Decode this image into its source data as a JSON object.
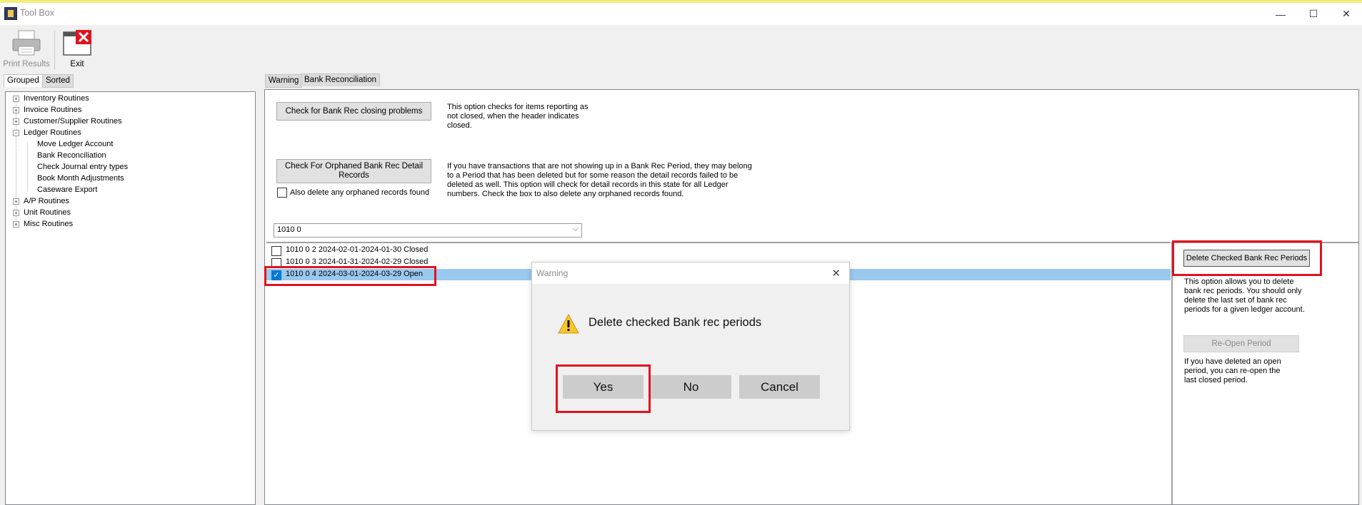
{
  "window": {
    "title": "Tool Box",
    "minimize": "—",
    "maximize": "☐",
    "close": "✕"
  },
  "toolbar": {
    "print_label": "Print Results",
    "exit_label": "Exit"
  },
  "left_tabs": {
    "grouped": "Grouped",
    "sorted": "Sorted"
  },
  "tree": {
    "items": [
      "Inventory Routines",
      "Invoice Routines",
      "Customer/Supplier Routines",
      "Ledger Routines",
      "Move Ledger Account",
      "Bank Reconciliation",
      "Check Journal entry types",
      "Book Month Adjustments",
      "Caseware Export",
      "A/P Routines",
      "Unit Routines",
      "Misc Routines"
    ]
  },
  "right_tabs": {
    "warning": "Warning",
    "bank_rec": "Bank Reconciliation"
  },
  "checks": {
    "closing_btn": "Check for Bank Rec closing problems",
    "closing_desc": "This option checks for items reporting as not closed, when the header indicates closed.",
    "orphan_btn": "Check For Orphaned Bank Rec Detail Records",
    "orphan_desc": "If you have transactions that are not showing up in a Bank Rec Period, they may belong to a Period that has been deleted but for some reason the detail records failed to be deleted as well.  This option will check for detail records in this state for all Ledger numbers.  Check the box to also delete any orphaned records found.",
    "orphan_checkbox_label": "Also delete any orphaned records found"
  },
  "ledger_select": {
    "value": "1010   0"
  },
  "periods": [
    {
      "label": "1010 0 2  2024-02-01-2024-01-30 Closed",
      "checked": false
    },
    {
      "label": "1010 0 3  2024-01-31-2024-02-29 Closed",
      "checked": false
    },
    {
      "label": "1010 0 4  2024-03-01-2024-03-29 Open",
      "checked": true
    }
  ],
  "side_panel": {
    "delete_btn": "Delete Checked Bank Rec Periods",
    "delete_desc": "This option allows you to delete bank rec periods.  You should only delete the last set of bank rec periods for a given ledger account.",
    "reopen_btn": "Re-Open Period",
    "reopen_desc": "If you have deleted an open period, you can re-open the last closed period."
  },
  "dialog": {
    "title": "Warning",
    "message": "Delete checked Bank rec periods",
    "yes": "Yes",
    "no": "No",
    "cancel": "Cancel",
    "close": "✕"
  },
  "colors": {
    "highlight": "#99c9ef",
    "callout_red": "#e0141e",
    "checkbox_blue": "#0078d7"
  }
}
